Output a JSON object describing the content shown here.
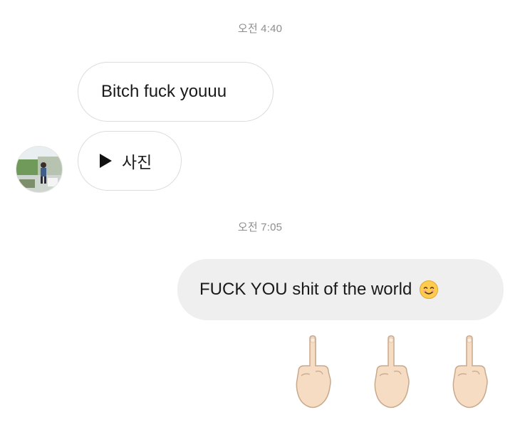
{
  "conversation": {
    "timestamps": [
      "오전 4:40",
      "오전 7:05"
    ],
    "messages": [
      {
        "sender": "other",
        "text": "Bitch fuck youuu"
      },
      {
        "sender": "other",
        "type": "photo",
        "label": "사진",
        "icon": "play-icon"
      },
      {
        "sender": "self",
        "text": "FUCK YOU shit of the world",
        "emoji": "smiling-face-icon"
      }
    ],
    "reactions": {
      "emoji": "middle-finger-icon",
      "count": 3
    }
  },
  "colors": {
    "sent_bubble": "#efefef",
    "received_border": "#dcdcdc",
    "timestamp": "#8e8e8e"
  }
}
